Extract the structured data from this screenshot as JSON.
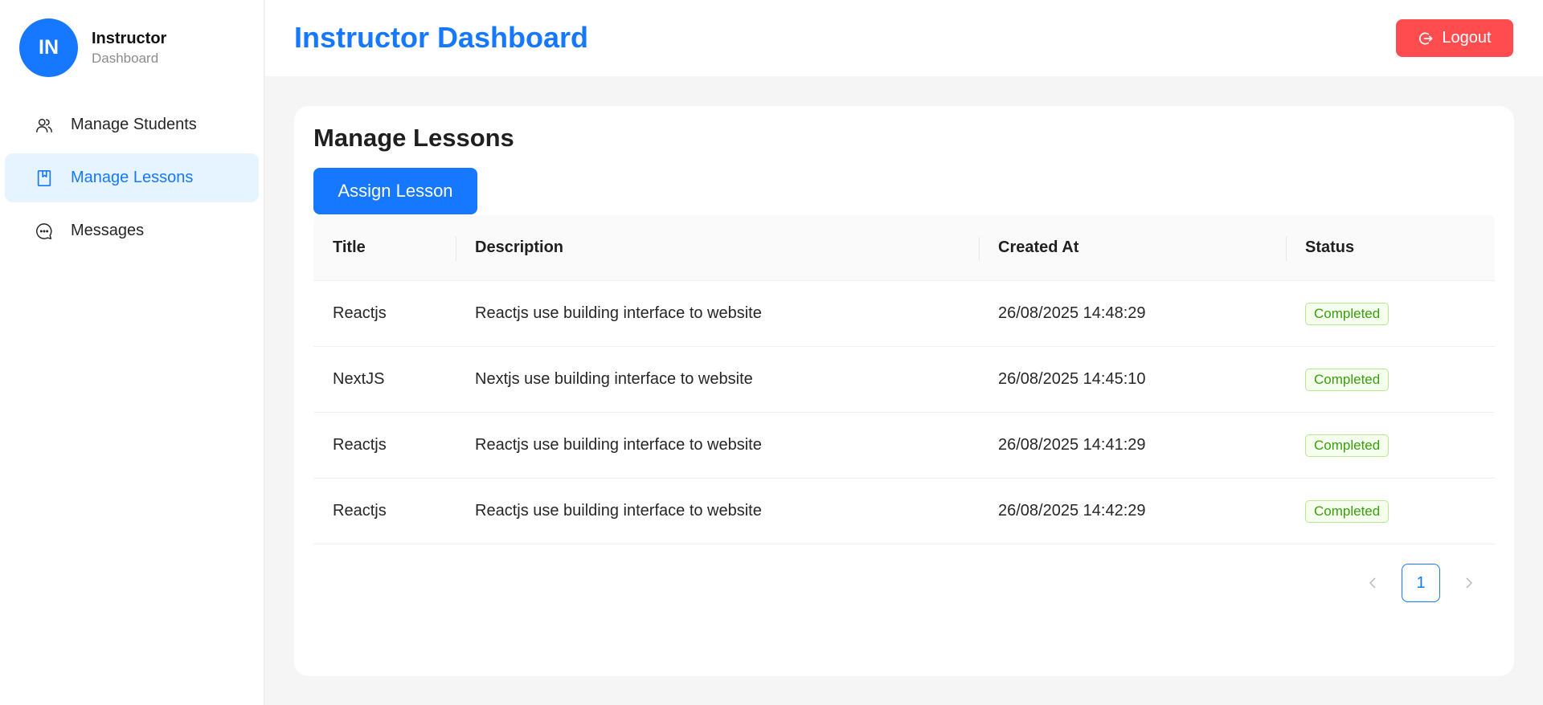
{
  "sidebar": {
    "avatar_initials": "IN",
    "profile_name": "Instructor",
    "profile_sub": "Dashboard",
    "items": [
      {
        "label": "Manage Students",
        "icon": "users-icon",
        "active": false
      },
      {
        "label": "Manage Lessons",
        "icon": "book-icon",
        "active": true
      },
      {
        "label": "Messages",
        "icon": "message-icon",
        "active": false
      }
    ]
  },
  "header": {
    "title": "Instructor Dashboard",
    "logout_label": "Logout"
  },
  "main": {
    "title": "Manage Lessons",
    "assign_label": "Assign Lesson",
    "columns": [
      "Title",
      "Description",
      "Created At",
      "Status"
    ],
    "rows": [
      {
        "title": "Reactjs",
        "description": "Reactjs use building interface to website",
        "created_at": "26/08/2025 14:48:29",
        "status": "Completed"
      },
      {
        "title": "NextJS",
        "description": "Nextjs use building interface to website",
        "created_at": "26/08/2025 14:45:10",
        "status": "Completed"
      },
      {
        "title": "Reactjs",
        "description": "Reactjs use building interface to website",
        "created_at": "26/08/2025 14:41:29",
        "status": "Completed"
      },
      {
        "title": "Reactjs",
        "description": "Reactjs use building interface to website",
        "created_at": "26/08/2025 14:42:29",
        "status": "Completed"
      }
    ],
    "pagination": {
      "current_page": "1"
    }
  },
  "colors": {
    "primary": "#1677ff",
    "danger": "#ff4d4f",
    "success": "#389e0d",
    "active_bg": "#e6f4ff"
  }
}
